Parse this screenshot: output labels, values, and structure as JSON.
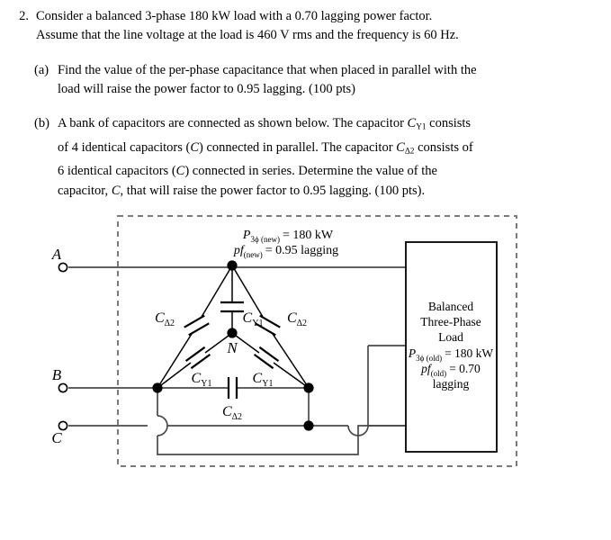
{
  "problem": {
    "number": "2.",
    "stem_line1": "Consider a balanced 3-phase 180 kW load with a 0.70 lagging power factor.",
    "stem_line2": "Assume that the line voltage at the load is 460 V rms and the frequency is 60 Hz.",
    "part_a": {
      "label": "(a)",
      "line1": "Find the value of the per-phase capacitance that when placed in parallel with the",
      "line2": "load will raise the power factor to 0.95 lagging.  (100 pts)"
    },
    "part_b": {
      "label": "(b)",
      "line1_a": "A bank of capacitors are connected as shown below.  The capacitor",
      "line1_sym": "C",
      "line1_sub": "Y1",
      "line1_b": "consists",
      "line2_a": "of 4 identical capacitors (",
      "line2_c": "C",
      "line2_b": ") connected in parallel.  The capacitor",
      "line2_sym": "C",
      "line2_sub": "Δ2",
      "line2_d": "consists of",
      "line3_a": "6 identical capacitors (",
      "line3_c": "C",
      "line3_b": ") connected in series.  Determine the value of the",
      "line4_a": "capacitor,",
      "line4_c": "C",
      "line4_b": ", that will raise the power factor to 0.95 lagging.  (100 pts)."
    }
  },
  "diagram": {
    "terminals": [
      {
        "name": "A",
        "label": "A"
      },
      {
        "name": "B",
        "label": "B"
      },
      {
        "name": "C",
        "label": "C"
      }
    ],
    "neutral_label": "N",
    "cap_delta_label": "C",
    "cap_delta_sub": "Δ2",
    "cap_wye_label": "C",
    "cap_wye_sub": "Y1",
    "cap_labels": {
      "delta_left": {
        "base": "C",
        "sub": "Δ2"
      },
      "delta_right": {
        "base": "C",
        "sub": "Δ2"
      },
      "delta_bottom": {
        "base": "C",
        "sub": "Δ2"
      },
      "wye_top": {
        "base": "C",
        "sub": "Y1"
      },
      "wye_left": {
        "base": "C",
        "sub": "Y1"
      },
      "wye_right": {
        "base": "C",
        "sub": "Y1"
      }
    },
    "new_annotation": {
      "line1_sym": "P",
      "line1_sub": "3ϕ (new)",
      "line1_val": "= 180 kW",
      "line2_sym": "pf",
      "line2_sub": "(new)",
      "line2_val": "= 0.95 lagging"
    },
    "load_box": {
      "line1": "Balanced",
      "line2": "Three-Phase",
      "line3": "Load",
      "line4_sym": "P",
      "line4_sub": "3ϕ (old)",
      "line4_val": "= 180 kW",
      "line5_sym": "pf",
      "line5_sub": "(old)",
      "line5_val": "= 0.70",
      "line6": "lagging"
    }
  },
  "colors": {
    "ink": "#000000",
    "wire": "#4a4a4a",
    "dashed": "#7a7a7a",
    "background": "#ffffff"
  }
}
